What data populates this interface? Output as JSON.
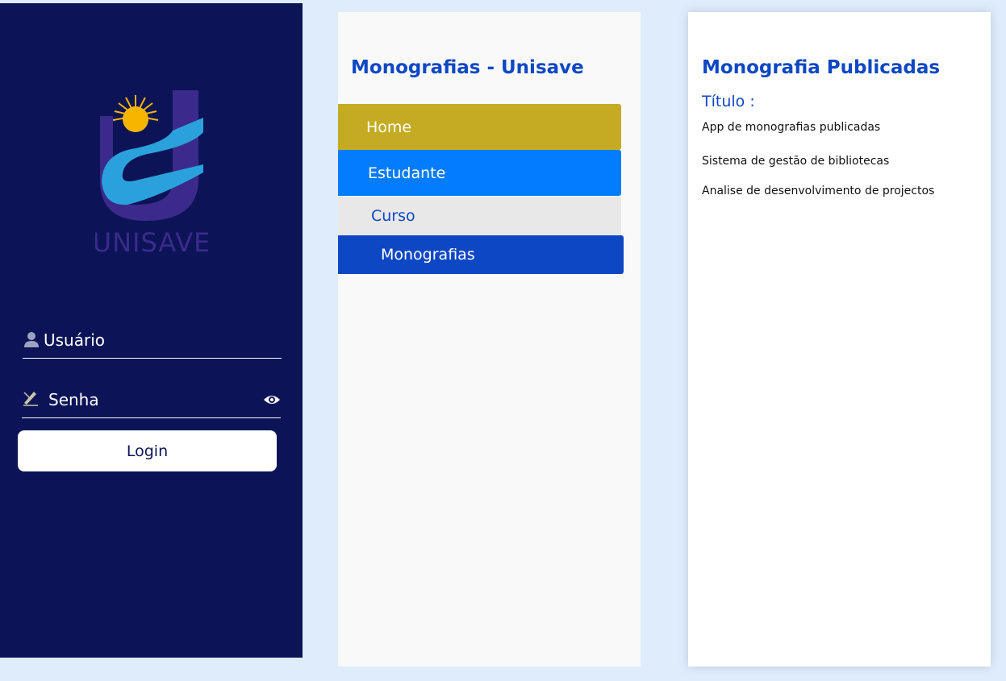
{
  "login": {
    "logo_text": "UNISAVE",
    "username_label": "Usuário",
    "password_label": "Senha",
    "login_button": "Login"
  },
  "menu": {
    "title": "Monografias - Unisave",
    "items": [
      {
        "label": "Home"
      },
      {
        "label": "Estudante"
      },
      {
        "label": "Curso"
      },
      {
        "label": "Monografias"
      }
    ]
  },
  "content": {
    "title": "Monografia Publicadas",
    "subtitle": "Título :",
    "items": [
      "App de monografias publicadas",
      "Sistema de gestão de bibliotecas",
      "Analise de desenvolvimento de projectos"
    ]
  },
  "colors": {
    "login_bg": "#0c1457",
    "home": "#c4ab23",
    "estudante": "#037cfd",
    "curso": "#e8e8e8",
    "monografias": "#0d47c4",
    "accent": "#0d47c4"
  }
}
